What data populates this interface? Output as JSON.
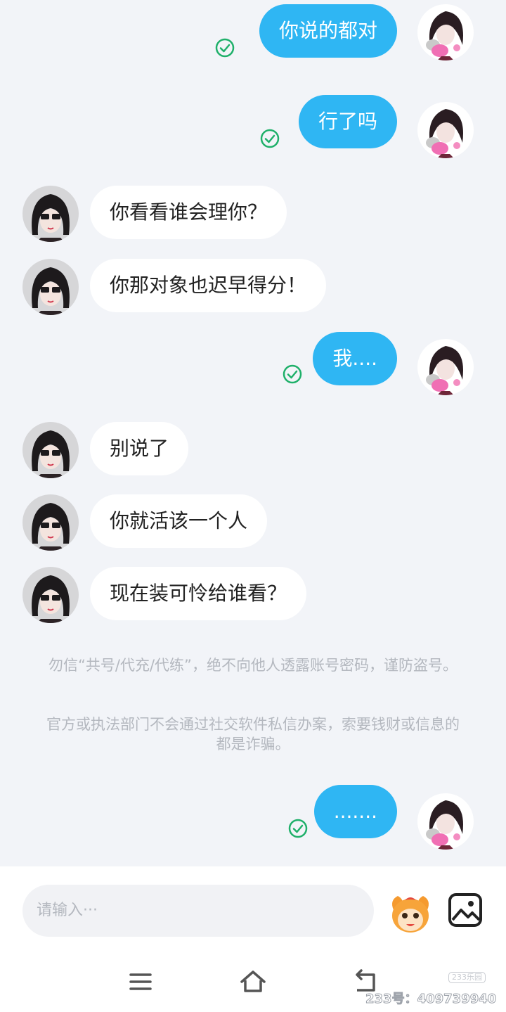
{
  "messages": [
    {
      "side": "mine",
      "text": "你说的都对",
      "read": true
    },
    {
      "side": "mine",
      "text": "行了吗",
      "read": true
    },
    {
      "side": "theirs",
      "text": "你看看谁会理你？"
    },
    {
      "side": "theirs",
      "text": "你那对象也迟早得分！"
    },
    {
      "side": "mine",
      "text": "我....",
      "read": true
    },
    {
      "side": "theirs",
      "text": "别说了"
    },
    {
      "side": "theirs",
      "text": "你就活该一个人"
    },
    {
      "side": "theirs",
      "text": "现在装可怜给谁看？"
    },
    {
      "side": "mine",
      "text": ".......",
      "read": true
    }
  ],
  "notice": {
    "line1": "勿信“共号/代充/代练”，绝不向他人透露账号密码，谨防盗号。",
    "line2": "官方或执法部门不会通过社交软件私信办案，索要钱财或信息的都是诈骗。"
  },
  "input": {
    "placeholder": "请输入···"
  },
  "icons": {
    "check": "check-circle-icon",
    "mascot": "emoji-mascot-icon",
    "image": "image-icon",
    "menu": "menu-icon",
    "home": "home-icon",
    "back": "back-icon"
  },
  "colors": {
    "accent": "#2fb6f3",
    "check": "#1fb06a",
    "background": "#f2f4f8"
  },
  "watermark": {
    "logo": "233乐园",
    "text": "233号：409739940"
  }
}
